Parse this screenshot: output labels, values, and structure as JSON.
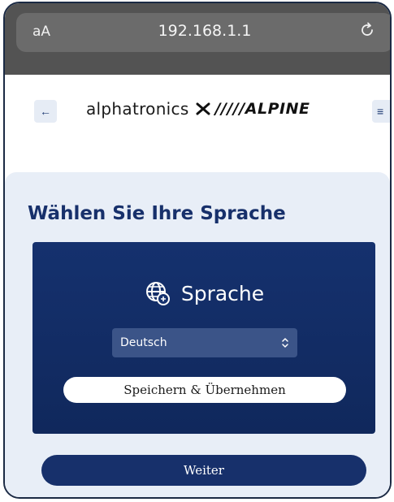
{
  "browser": {
    "text_size_label": "aA",
    "url": "192.168.1.1",
    "reload_icon": "reload-icon"
  },
  "header": {
    "back_icon": "arrow-left-icon",
    "back_glyph": "←",
    "logo": {
      "brand_left": "alphatronics",
      "separator": "✕",
      "brand_right": "/////ALPINE"
    },
    "menu_icon": "hamburger-menu-icon",
    "menu_glyph": "≡"
  },
  "main": {
    "title": "Wählen Sie Ihre Sprache",
    "panel": {
      "heading_icon": "globe-icon",
      "heading_label": "Sprache",
      "language_select": {
        "value": "Deutsch",
        "chevron_icon": "select-chevron-icon"
      },
      "save_button_label": "Speichern & Übernehmen"
    },
    "next_button_label": "Weiter"
  },
  "colors": {
    "navy": "#17306b",
    "panel_navy": "#15316e",
    "select_bg": "#3b5488",
    "page_bg": "#e8eef7",
    "chrome_bg": "#535353"
  }
}
